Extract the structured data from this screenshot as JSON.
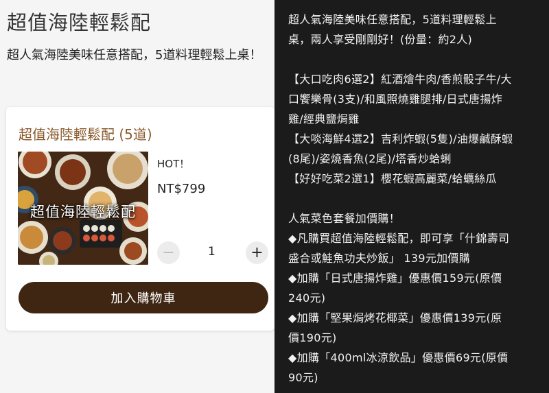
{
  "page": {
    "title": "超值海陸輕鬆配",
    "description": "超人氣海陸美味任意搭配，5道料理輕鬆上桌！"
  },
  "product": {
    "card_title": "超值海陸輕鬆配 (5道)",
    "image_caption": "超值海陸輕鬆配",
    "tag": "HOT！",
    "price": "NT$799",
    "quantity": "1",
    "minus_symbol": "−",
    "plus_symbol": "+",
    "add_to_cart_label": "加入購物車"
  },
  "details": {
    "lines": [
      "超人氣海陸美味任意搭配，5道料理輕鬆上",
      "桌，兩人享受剛剛好！(份量：約2人)",
      "",
      "【大口吃肉6選2】紅酒燴牛肉/香煎骰子牛/大",
      "口饗樂骨(3支)/和風照燒雞腿排/日式唐揚炸",
      "雞/經典鹽焗雞",
      "【大啖海鮮4選2】吉利炸蝦(5隻)/油爆鹹酥蝦",
      "(8尾)/姿燒香魚(2尾)/塔香炒蛤蜊",
      "【好好吃菜2選1】櫻花蝦高麗菜/蛤蠣絲瓜",
      "",
      "人氣菜色套餐加價購！",
      "◆凡購買超值海陸輕鬆配，即可享「什錦壽司",
      "盛合或鮭魚功夫炒飯」 139元加價購",
      "◆加購「日式唐揚炸雞」優惠價159元(原價",
      "240元)",
      "◆加購「堅果焗烤花椰菜」優惠價139元(原",
      "價190元)",
      "◆加購「400ml冰涼飲品」優惠價69元(原價",
      "90元)"
    ]
  },
  "colors": {
    "accent_brown": "#8a5a2b",
    "button_dark": "#3e2613",
    "panel_dark": "#1b1b1b"
  }
}
